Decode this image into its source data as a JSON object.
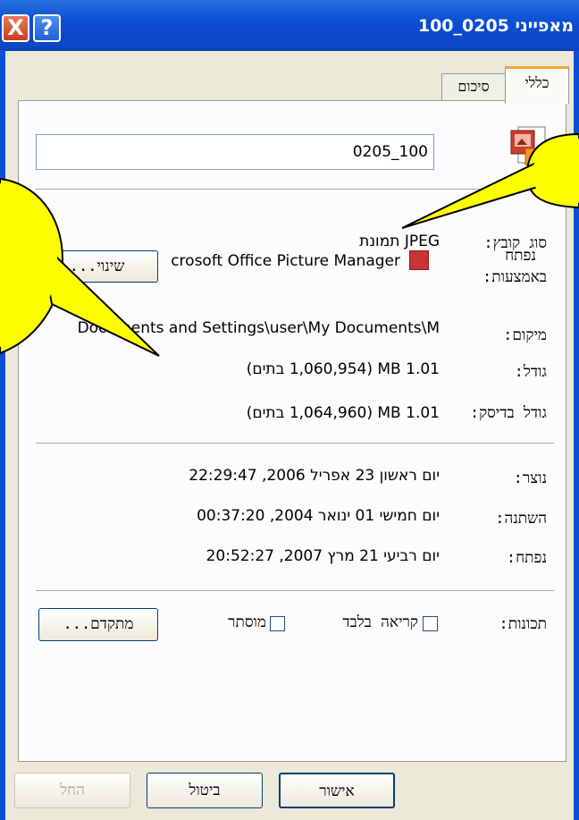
{
  "window": {
    "title": "מאפייני 0205_100",
    "close_glyph": "X",
    "help_glyph": "?"
  },
  "tabs": [
    {
      "label": "כללי",
      "active": true
    },
    {
      "label": "סיכום",
      "active": false
    }
  ],
  "file_name": "0205_100",
  "fields": {
    "type_label": "סוג קובץ:",
    "type_value": "JPEG תמונת",
    "opens_with_label_1": "נפתח",
    "opens_with_label_2": "באמצעות:",
    "opens_with_value": "crosoft Office Picture Manager",
    "change_button": "שינוי...",
    "location_label": "מיקום:",
    "location_value": "Documents and Settings\\user\\My Documents\\M",
    "size_label": "גודל:",
    "size_value": "1.01 MB (1,060,954 בתים)",
    "disk_size_label": "גודל בדיסק:",
    "disk_size_value": "1.01 MB (1,064,960 בתים)",
    "created_label": "נוצר:",
    "created_value": "יום ראשון 23 אפריל 2006, 22:29:47",
    "modified_label": "השתנה:",
    "modified_value": "יום חמישי 01 ינואר 2004, 00:37:20",
    "accessed_label": "נפתח:",
    "accessed_value": "יום רביעי 21 מרץ 2007, 20:52:27",
    "attributes_label": "תכונות:",
    "readonly_label": "קריאה בלבד",
    "hidden_label": "מוסתר",
    "advanced_button": "מתקדם..."
  },
  "footer": {
    "ok": "אישור",
    "cancel": "ביטול",
    "apply": "החל"
  },
  "icons": {
    "file": "picture-file-icon",
    "app": "picture-manager-icon"
  },
  "colors": {
    "titlebar": "#0b4fd4",
    "callout": "#ffff00",
    "tab_highlight": "#f7a436"
  }
}
